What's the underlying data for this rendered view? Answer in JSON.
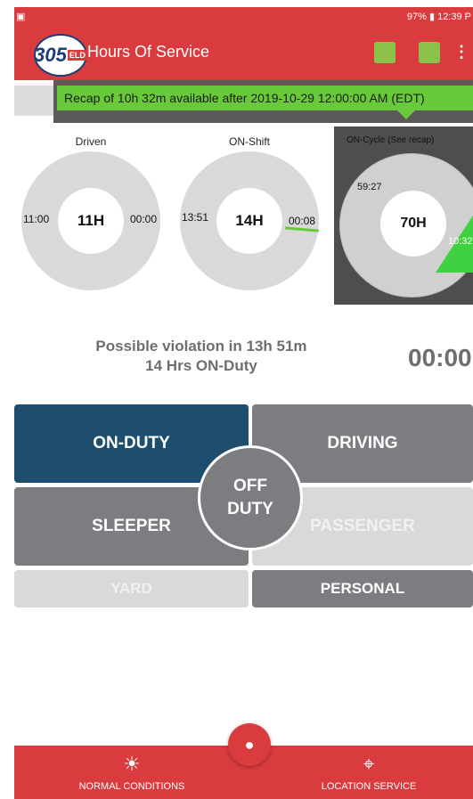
{
  "status_bar": {
    "left": "▣",
    "right": "97% ▮ 12:39 P"
  },
  "app_bar": {
    "logo_number": "305",
    "logo_tag": "ELD",
    "title": "Hours Of Service",
    "menu_glyph": "⋮"
  },
  "tooltip": {
    "text": "Recap of 10h 32m available after 2019-10-29 12:00:00 AM (EDT)"
  },
  "gauges": {
    "driven": {
      "label": "Driven",
      "center": "11H",
      "left_value": "11:00",
      "right_value": "00:00"
    },
    "on_shift": {
      "label": "ON-Shift",
      "center": "14H",
      "left_value": "13:51",
      "right_value": "00:08"
    },
    "on_cycle": {
      "label": "ON-Cycle (See recap)",
      "center": "70H",
      "left_value": "59:27",
      "right_value": "10:32"
    }
  },
  "violation": {
    "line1": "Possible violation in 13h 51m",
    "line2": "14 Hrs ON-Duty"
  },
  "timer": "00:00",
  "duty_buttons": {
    "on_duty": "ON-DUTY",
    "driving": "DRIVING",
    "off_duty_line1": "OFF",
    "off_duty_line2": "DUTY",
    "sleeper": "SLEEPER",
    "passenger": "PASSENGER",
    "yard": "YARD",
    "personal": "PERSONAL"
  },
  "bottom_bar": {
    "normal_conditions": "NORMAL CONDITIONS",
    "location_service": "LOCATION SERVICE"
  },
  "colors": {
    "brand_red": "#d93b3e",
    "on_duty_blue": "#1d4e6e",
    "button_grey": "#7c7d80",
    "accent_green": "#68c93b"
  }
}
